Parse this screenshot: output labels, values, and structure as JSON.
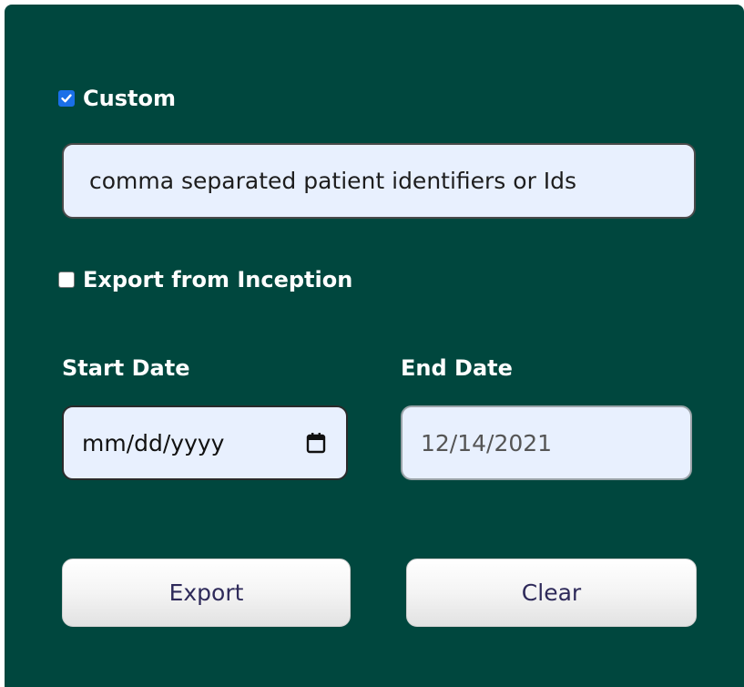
{
  "form": {
    "custom_checkbox": {
      "label": "Custom",
      "checked": true
    },
    "identifiers_input": {
      "value": "comma separated patient identifiers or Ids",
      "placeholder": "comma separated patient identifiers or Ids"
    },
    "inception_checkbox": {
      "label": "Export from Inception",
      "checked": false
    },
    "start_date": {
      "label": "Start Date",
      "value": "mm/dd/yyyy",
      "icon": "calendar-icon"
    },
    "end_date": {
      "label": "End Date",
      "value": "12/14/2021"
    },
    "buttons": {
      "export_label": "Export",
      "clear_label": "Clear"
    }
  },
  "colors": {
    "panel_background": "#00473e",
    "input_background": "#e8f0fe",
    "checkbox_accent": "#1a6fe8",
    "button_text": "#2e2a5a"
  }
}
